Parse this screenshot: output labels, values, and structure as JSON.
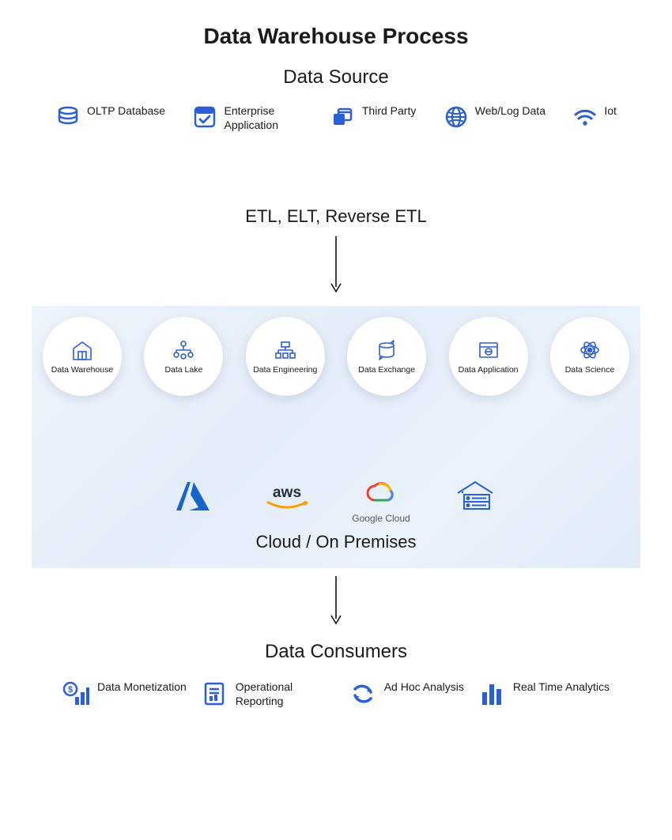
{
  "title": "Data Warehouse Process",
  "sections": {
    "data_source": {
      "heading": "Data Source",
      "items": [
        {
          "icon": "database-icon",
          "label": "OLTP Database"
        },
        {
          "icon": "checkbox-icon",
          "label": "Enterprise Application"
        },
        {
          "icon": "windows-stack-icon",
          "label": "Third Party"
        },
        {
          "icon": "globe-icon",
          "label": "Web/Log Data"
        },
        {
          "icon": "wifi-icon",
          "label": "Iot"
        }
      ]
    },
    "etl": {
      "text": "ETL, ELT, Reverse ETL"
    },
    "components": {
      "items": [
        {
          "icon": "warehouse-icon",
          "label": "Data Warehouse"
        },
        {
          "icon": "data-lake-icon",
          "label": "Data Lake"
        },
        {
          "icon": "engineering-icon",
          "label": "Data Engineering"
        },
        {
          "icon": "exchange-icon",
          "label": "Data Exchange"
        },
        {
          "icon": "application-icon",
          "label": "Data Application"
        },
        {
          "icon": "science-icon",
          "label": "Data Science"
        }
      ]
    },
    "providers": {
      "label": "Cloud / On Premises",
      "items": [
        {
          "icon": "azure-icon",
          "label": ""
        },
        {
          "icon": "aws-icon",
          "label": ""
        },
        {
          "icon": "gcp-icon",
          "label": "Google Cloud"
        },
        {
          "icon": "onprem-icon",
          "label": ""
        }
      ]
    },
    "consumers": {
      "heading": "Data Consumers",
      "items": [
        {
          "icon": "money-bar-icon",
          "label": "Data Monetization"
        },
        {
          "icon": "report-icon",
          "label": "Operational Reporting"
        },
        {
          "icon": "refresh-icon",
          "label": "Ad Hoc Analysis"
        },
        {
          "icon": "bar-chart-icon",
          "label": "Real Time Analytics"
        }
      ]
    }
  },
  "colors": {
    "accent": "#2a5fd6",
    "text": "#1a1a1a"
  }
}
